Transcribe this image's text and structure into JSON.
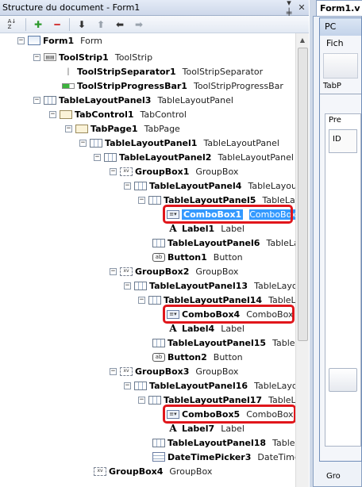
{
  "panel": {
    "title": "Structure du document - Form1",
    "pin_glyph": "▾ ╪",
    "close_glyph": "✕"
  },
  "toolbar": {
    "sort_icon": "sort-az-icon",
    "add_glyph": "✚",
    "delete_glyph": "━",
    "down_glyph": "⬇",
    "up_glyph": "⬆",
    "left_glyph": "⬅",
    "right_glyph": "➡"
  },
  "tree": [
    {
      "name": "Form1",
      "type": "Form",
      "icon": "form-icon"
    },
    {
      "name": "ToolStrip1",
      "type": "ToolStrip",
      "icon": "toolstrip-icon"
    },
    {
      "name": "ToolStripSeparator1",
      "type": "ToolStripSeparator",
      "icon": "separator-icon"
    },
    {
      "name": "ToolStripProgressBar1",
      "type": "ToolStripProgressBar",
      "icon": "progressbar-icon"
    },
    {
      "name": "TableLayoutPanel3",
      "type": "TableLayoutPanel",
      "icon": "tablelayout-icon"
    },
    {
      "name": "TabControl1",
      "type": "TabControl",
      "icon": "tabcontrol-icon"
    },
    {
      "name": "TabPage1",
      "type": "TabPage",
      "icon": "tabpage-icon"
    },
    {
      "name": "TableLayoutPanel1",
      "type": "TableLayoutPanel",
      "icon": "tablelayout-icon"
    },
    {
      "name": "TableLayoutPanel2",
      "type": "TableLayoutPanel",
      "icon": "tablelayout-icon"
    },
    {
      "name": "GroupBox1",
      "type": "GroupBox",
      "icon": "groupbox-icon"
    },
    {
      "name": "TableLayoutPanel4",
      "type": "TableLayout",
      "icon": "tablelayout-icon"
    },
    {
      "name": "TableLayoutPanel5",
      "type": "TableLay",
      "icon": "tablelayout-icon"
    },
    {
      "name": "ComboBox1",
      "type": "ComboBox",
      "icon": "combobox-icon",
      "selected": true
    },
    {
      "name": "Label1",
      "type": "Label",
      "icon": "label-icon"
    },
    {
      "name": "TableLayoutPanel6",
      "type": "TableLay",
      "icon": "tablelayout-icon"
    },
    {
      "name": "Button1",
      "type": "Button",
      "icon": "button-icon"
    },
    {
      "name": "GroupBox2",
      "type": "GroupBox",
      "icon": "groupbox-icon"
    },
    {
      "name": "TableLayoutPanel13",
      "type": "TableLayo",
      "icon": "tablelayout-icon"
    },
    {
      "name": "TableLayoutPanel14",
      "type": "TableL",
      "icon": "tablelayout-icon"
    },
    {
      "name": "ComboBox4",
      "type": "ComboBox",
      "icon": "combobox-icon"
    },
    {
      "name": "Label4",
      "type": "Label",
      "icon": "label-icon"
    },
    {
      "name": "TableLayoutPanel15",
      "type": "TableL",
      "icon": "tablelayout-icon"
    },
    {
      "name": "Button2",
      "type": "Button",
      "icon": "button-icon"
    },
    {
      "name": "GroupBox3",
      "type": "GroupBox",
      "icon": "groupbox-icon"
    },
    {
      "name": "TableLayoutPanel16",
      "type": "TableLayo",
      "icon": "tablelayout-icon"
    },
    {
      "name": "TableLayoutPanel17",
      "type": "TableL",
      "icon": "tablelayout-icon"
    },
    {
      "name": "ComboBox5",
      "type": "ComboBox",
      "icon": "combobox-icon"
    },
    {
      "name": "Label7",
      "type": "Label",
      "icon": "label-icon"
    },
    {
      "name": "TableLayoutPanel18",
      "type": "TableL",
      "icon": "tablelayout-icon"
    },
    {
      "name": "DateTimePicker3",
      "type": "DateTimeP",
      "icon": "datetimepicker-icon"
    },
    {
      "name": "GroupBox4",
      "type": "GroupBox",
      "icon": "groupbox-icon"
    }
  ],
  "doc": {
    "tab_label": "Form1.v",
    "form_title": "PC",
    "menu_item": "Fich",
    "tab_header": "TabP",
    "inner_label": "Pre",
    "inner_box": "ID",
    "bottom_text": "Gro"
  },
  "colors": {
    "highlight": "#e0161b",
    "selection": "#3399ff"
  }
}
